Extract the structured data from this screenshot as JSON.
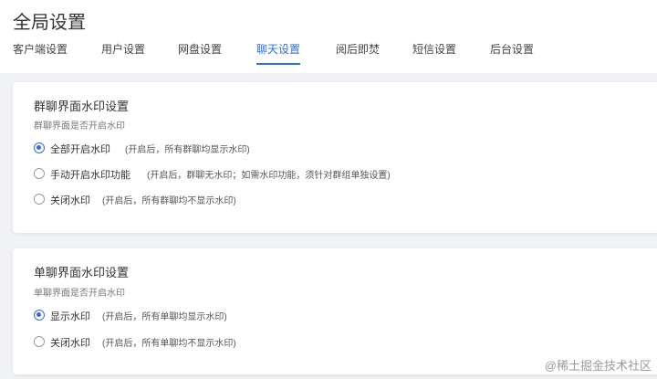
{
  "page": {
    "title": "全局设置"
  },
  "tabs": [
    {
      "label": "客户端设置",
      "active": false
    },
    {
      "label": "用户设置",
      "active": false
    },
    {
      "label": "网盘设置",
      "active": false
    },
    {
      "label": "聊天设置",
      "active": true
    },
    {
      "label": "阅后即焚",
      "active": false
    },
    {
      "label": "短信设置",
      "active": false
    },
    {
      "label": "后台设置",
      "active": false
    }
  ],
  "group_watermark": {
    "title": "群聊界面水印设置",
    "subtitle": "群聊界面是否开启水印",
    "options": [
      {
        "label": "全部开启水印",
        "note": "(开启后，所有群聊均显示水印)",
        "selected": true
      },
      {
        "label": "手动开启水印功能",
        "note": "(开启后，群聊无水印；如需水印功能，须针对群组单独设置)",
        "selected": false
      },
      {
        "label": "关闭水印",
        "note": "(开启后，所有群聊均不显示水印)",
        "selected": false
      }
    ]
  },
  "single_watermark": {
    "title": "单聊界面水印设置",
    "subtitle": "单聊界面是否开启水印",
    "options": [
      {
        "label": "显示水印",
        "note": "(开启后，所有单聊均显示水印)",
        "selected": true
      },
      {
        "label": "关闭水印",
        "note": "(开启后，所有单聊均不显示水印)",
        "selected": false
      }
    ]
  },
  "image_watermark": "@稀土掘金技术社区",
  "colors": {
    "accent": "#2f6fde",
    "background": "#f0f2f5"
  }
}
